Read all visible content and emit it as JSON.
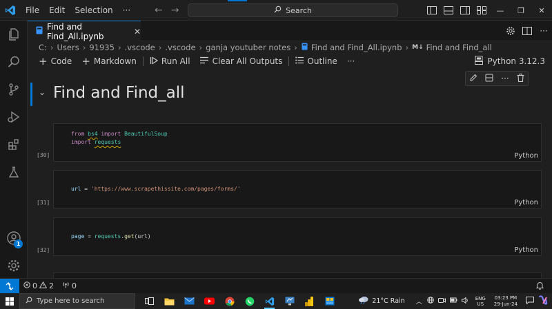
{
  "menu": {
    "items": [
      "File",
      "Edit",
      "Selection",
      "···"
    ]
  },
  "search": {
    "label": "Search"
  },
  "tab": {
    "title": "Find and Find_All.ipynb",
    "close": "✕"
  },
  "breadcrumb": {
    "items": [
      "C:",
      "Users",
      "91935",
      ".vscode",
      ".vscode",
      "ganja youtuber notes",
      "Find and Find_All.ipynb",
      "Find and Find_all"
    ],
    "md_badge": "M↓"
  },
  "toolbar": {
    "code": "Code",
    "markdown": "Markdown",
    "run_all": "Run All",
    "clear_outputs": "Clear All Outputs",
    "outline": "Outline",
    "more": "···",
    "kernel": "Python 3.12.3"
  },
  "markdown_cell": {
    "title": "Find and Find_all"
  },
  "cells": [
    {
      "exec": "[30]",
      "lang": "Python",
      "lines": [
        [
          "from",
          " ",
          "bs4",
          " ",
          "import",
          " ",
          "BeautifulSoup"
        ],
        [
          "import",
          " ",
          "requests"
        ]
      ]
    },
    {
      "exec": "[31]",
      "lang": "Python",
      "code": {
        "var": "url",
        "op": " = ",
        "str": "'https://www.scrapethissite.com/pages/forms/'"
      }
    },
    {
      "exec": "[32]",
      "lang": "Python",
      "code": {
        "var": "page",
        "op": " = ",
        "obj": "requests",
        "dot": ".",
        "fn": "get",
        "args": "(url)"
      }
    }
  ],
  "status": {
    "errors": "0",
    "warnings": "2",
    "ports": "0"
  },
  "taskbar": {
    "search_placeholder": "Type here to search",
    "weather": "21°C  Rain",
    "lang_line1": "ENG",
    "lang_line2": "US",
    "time": "03:23 PM",
    "date": "29-Jun-24"
  },
  "colors": {
    "accent": "#0078d4",
    "keyword": "#c586c0",
    "string": "#ce9178",
    "function": "#dcdcaa",
    "variable": "#9cdcfe"
  }
}
